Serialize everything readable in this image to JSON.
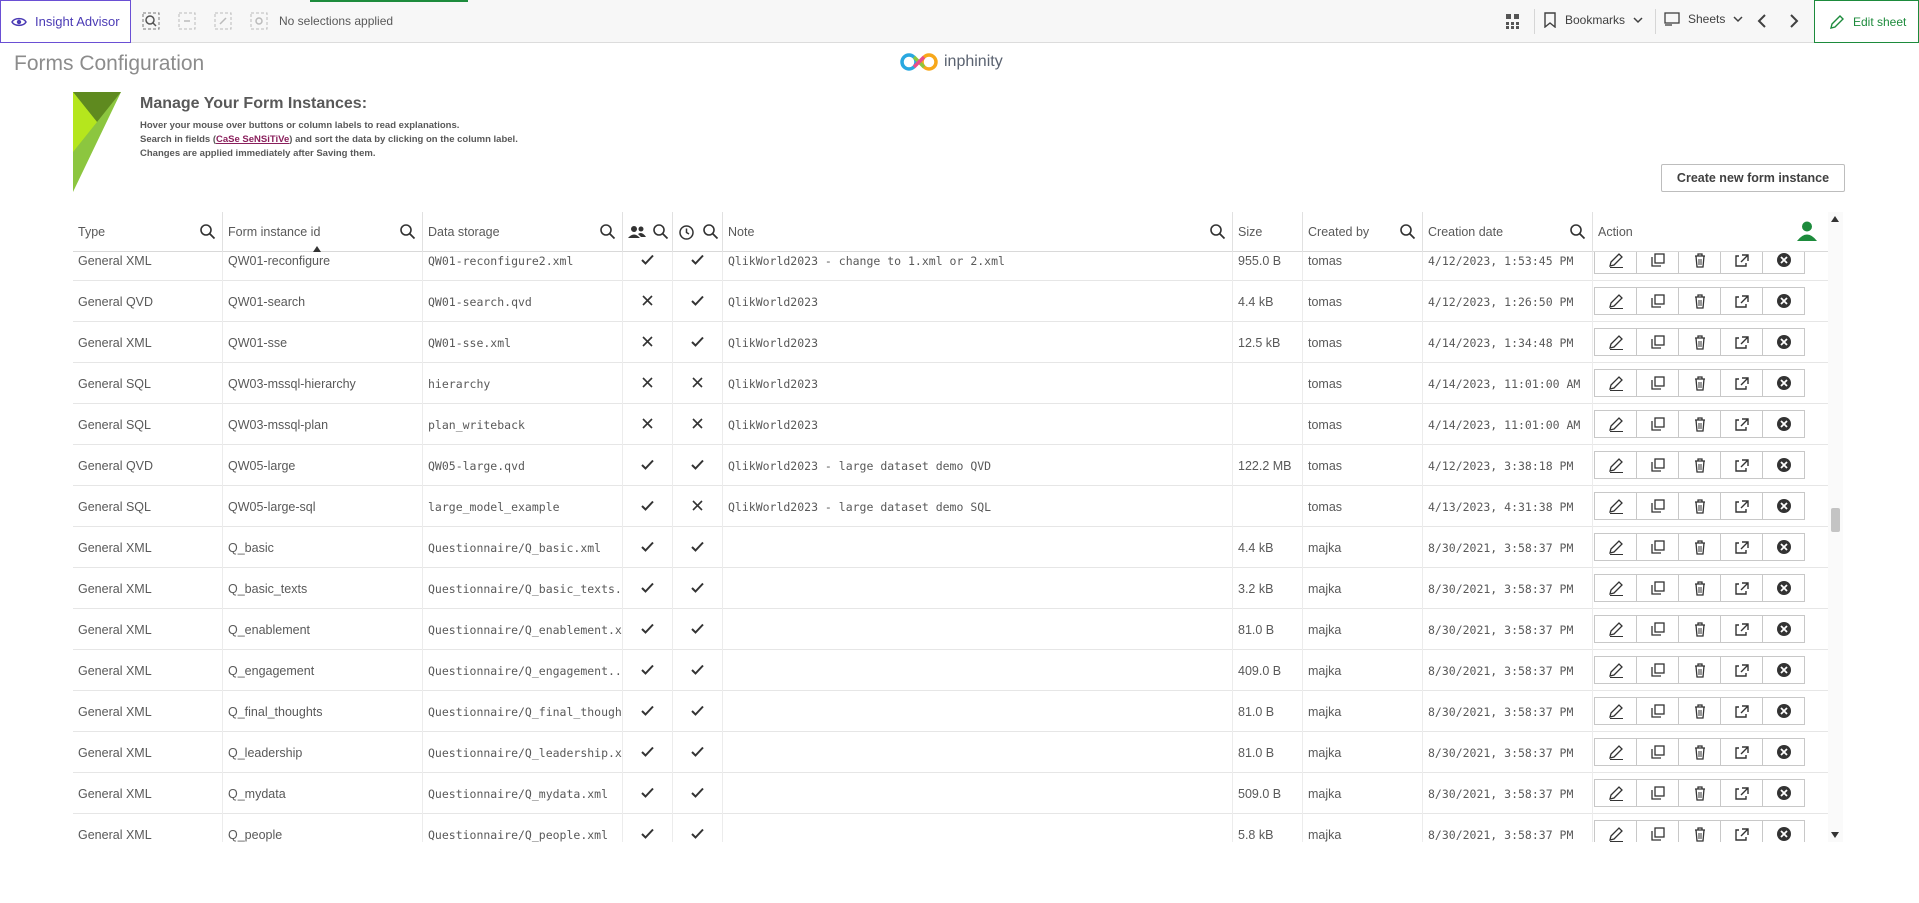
{
  "toolbar": {
    "insight_label": "Insight Advisor",
    "selections_label": "No selections applied",
    "bookmarks_label": "Bookmarks",
    "sheets_label": "Sheets",
    "edit_sheet_label": "Edit sheet"
  },
  "header": {
    "title": "Forms Configuration",
    "logo_text": "inphinity"
  },
  "intro": {
    "heading": "Manage Your Form Instances:",
    "line1": "Hover your mouse over buttons or column labels to read explanations.",
    "line2_before": "Search in fields (",
    "line2_case": "CaSe SeNSiTiVe",
    "line2_after": ") and sort the data by clicking on the column label.",
    "line3": "Changes are applied immediately after Saving them."
  },
  "create_button_label": "Create new form instance",
  "columns": {
    "type": "Type",
    "form_id": "Form instance id",
    "storage": "Data storage",
    "note": "Note",
    "size": "Size",
    "created_by": "Created by",
    "creation_date": "Creation date",
    "action": "Action"
  },
  "rows": [
    {
      "type": "General XML",
      "id": "QW01-reconfigure",
      "storage": "QW01-reconfigure2.xml",
      "shared": true,
      "history": true,
      "note": "QlikWorld2023 - change to 1.xml or 2.xml",
      "size": "955.0 B",
      "by": "tomas",
      "date": "4/12/2023, 1:53:45 PM"
    },
    {
      "type": "General QVD",
      "id": "QW01-search",
      "storage": "QW01-search.qvd",
      "shared": false,
      "history": true,
      "note": "QlikWorld2023",
      "size": "4.4 kB",
      "by": "tomas",
      "date": "4/12/2023, 1:26:50 PM"
    },
    {
      "type": "General XML",
      "id": "QW01-sse",
      "storage": "QW01-sse.xml",
      "shared": false,
      "history": true,
      "note": "QlikWorld2023",
      "size": "12.5 kB",
      "by": "tomas",
      "date": "4/14/2023, 1:34:48 PM"
    },
    {
      "type": "General SQL",
      "id": "QW03-mssql-hierarchy",
      "storage": "hierarchy",
      "shared": false,
      "history": false,
      "note": "QlikWorld2023",
      "size": "",
      "by": "tomas",
      "date": "4/14/2023, 11:01:00 AM"
    },
    {
      "type": "General SQL",
      "id": "QW03-mssql-plan",
      "storage": "plan_writeback",
      "shared": false,
      "history": false,
      "note": "QlikWorld2023",
      "size": "",
      "by": "tomas",
      "date": "4/14/2023, 11:01:00 AM"
    },
    {
      "type": "General QVD",
      "id": "QW05-large",
      "storage": "QW05-large.qvd",
      "shared": true,
      "history": true,
      "note": "QlikWorld2023 - large dataset demo QVD",
      "size": "122.2 MB",
      "by": "tomas",
      "date": "4/12/2023, 3:38:18 PM"
    },
    {
      "type": "General SQL",
      "id": "QW05-large-sql",
      "storage": "large_model_example",
      "shared": true,
      "history": false,
      "note": "QlikWorld2023 - large dataset demo SQL",
      "size": "",
      "by": "tomas",
      "date": "4/13/2023, 4:31:38 PM"
    },
    {
      "type": "General XML",
      "id": "Q_basic",
      "storage": "Questionnaire/Q_basic.xml",
      "shared": true,
      "history": true,
      "note": "",
      "size": "4.4 kB",
      "by": "majka",
      "date": "8/30/2021, 3:58:37 PM"
    },
    {
      "type": "General XML",
      "id": "Q_basic_texts",
      "storage": "Questionnaire/Q_basic_texts.xml",
      "shared": true,
      "history": true,
      "note": "",
      "size": "3.2 kB",
      "by": "majka",
      "date": "8/30/2021, 3:58:37 PM"
    },
    {
      "type": "General XML",
      "id": "Q_enablement",
      "storage": "Questionnaire/Q_enablement.x...",
      "shared": true,
      "history": true,
      "note": "",
      "size": "81.0 B",
      "by": "majka",
      "date": "8/30/2021, 3:58:37 PM"
    },
    {
      "type": "General XML",
      "id": "Q_engagement",
      "storage": "Questionnaire/Q_engagement....",
      "shared": true,
      "history": true,
      "note": "",
      "size": "409.0 B",
      "by": "majka",
      "date": "8/30/2021, 3:58:37 PM"
    },
    {
      "type": "General XML",
      "id": "Q_final_thoughts",
      "storage": "Questionnaire/Q_final_thought...",
      "shared": true,
      "history": true,
      "note": "",
      "size": "81.0 B",
      "by": "majka",
      "date": "8/30/2021, 3:58:37 PM"
    },
    {
      "type": "General XML",
      "id": "Q_leadership",
      "storage": "Questionnaire/Q_leadership.xml",
      "shared": true,
      "history": true,
      "note": "",
      "size": "81.0 B",
      "by": "majka",
      "date": "8/30/2021, 3:58:37 PM"
    },
    {
      "type": "General XML",
      "id": "Q_mydata",
      "storage": "Questionnaire/Q_mydata.xml",
      "shared": true,
      "history": true,
      "note": "",
      "size": "509.0 B",
      "by": "majka",
      "date": "8/30/2021, 3:58:37 PM"
    },
    {
      "type": "General XML",
      "id": "Q_people",
      "storage": "Questionnaire/Q_people.xml",
      "shared": true,
      "history": true,
      "note": "",
      "size": "5.8 kB",
      "by": "majka",
      "date": "8/30/2021, 3:58:37 PM"
    }
  ],
  "icons": {
    "add_user": "person-add-icon",
    "edit": "pencil-icon",
    "duplicate": "duplicate-icon",
    "delete": "trash-icon",
    "export": "export-icon",
    "remove": "close-circle-icon"
  },
  "colors": {
    "accent": "#1d8b3c",
    "insight": "#4b3bb5",
    "logo_green": "#8cc63f"
  }
}
